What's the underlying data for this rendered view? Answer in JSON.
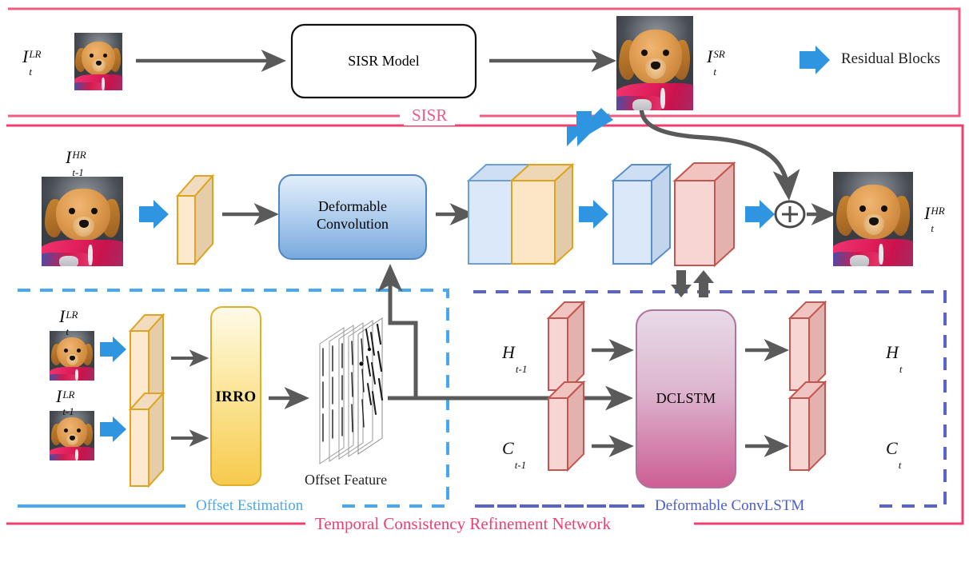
{
  "figure": {
    "title": "Temporal Consistency Refinement Network architecture diagram",
    "colors": {
      "frame_pink": "#ee5b83",
      "frame_pink_dark": "#ee3f6e",
      "offset_blue": "#4aa8f0",
      "convlstm_purple": "#5a63c8",
      "residual_arrow_blue": "#2f95e0",
      "gray_arrow": "#5a5a5a",
      "cube_orange_border": "#e0a320",
      "cube_orange_fill": "#fbe3c2",
      "cube_blue_border": "#6d9fd4",
      "cube_blue_fill": "#d9e7f8",
      "cube_red_border": "#c4564f",
      "cube_red_fill": "#f6d4d2",
      "deform_conv_top": "#dce9f8",
      "deform_conv_bottom": "#6fa3dd",
      "irro_top": "#fdf6dd",
      "irro_bottom": "#f5c442",
      "dclstm_top": "#e6d4e2",
      "dclstm_bottom": "#cf5f95"
    }
  },
  "legend": {
    "residual_blocks_label": "Residual Blocks",
    "arrow_icon": "residual-block-arrow-icon"
  },
  "sisr_section": {
    "frame_label": "SISR",
    "input_label": {
      "base": "I",
      "sup": "LR",
      "sub": "t"
    },
    "model_block_label": "SISR Model",
    "output_label": {
      "base": "I",
      "sup": "SR",
      "sub": "t"
    }
  },
  "tcrn_section": {
    "frame_label": "Temporal Consistency Refinement Network",
    "prev_hr_label": {
      "base": "I",
      "sup": "HR",
      "sub": "t-1"
    },
    "deform_conv_label_line1": "Deformable",
    "deform_conv_label_line2": "Convolution",
    "output_hr_label": {
      "base": "I",
      "sup": "HR",
      "sub": "t"
    },
    "sum_node_symbol": "+"
  },
  "offset_estimation": {
    "frame_label": "Offset Estimation",
    "input_t_label": {
      "base": "I",
      "sup": "LR",
      "sub": "t"
    },
    "input_tm1_label": {
      "base": "I",
      "sup": "LR",
      "sub": "t-1"
    },
    "irro_block_label": "IRRO",
    "offset_feature_label": "Offset Feature"
  },
  "deformable_convlstm": {
    "frame_label": "Deformable ConvLSTM",
    "input_h_label": {
      "base": "H",
      "sub": "t-1"
    },
    "input_c_label": {
      "base": "C",
      "sub": "t-1"
    },
    "block_label": "DCLSTM",
    "output_h_label": {
      "base": "H",
      "sub": "t"
    },
    "output_c_label": {
      "base": "C",
      "sub": "t"
    }
  }
}
